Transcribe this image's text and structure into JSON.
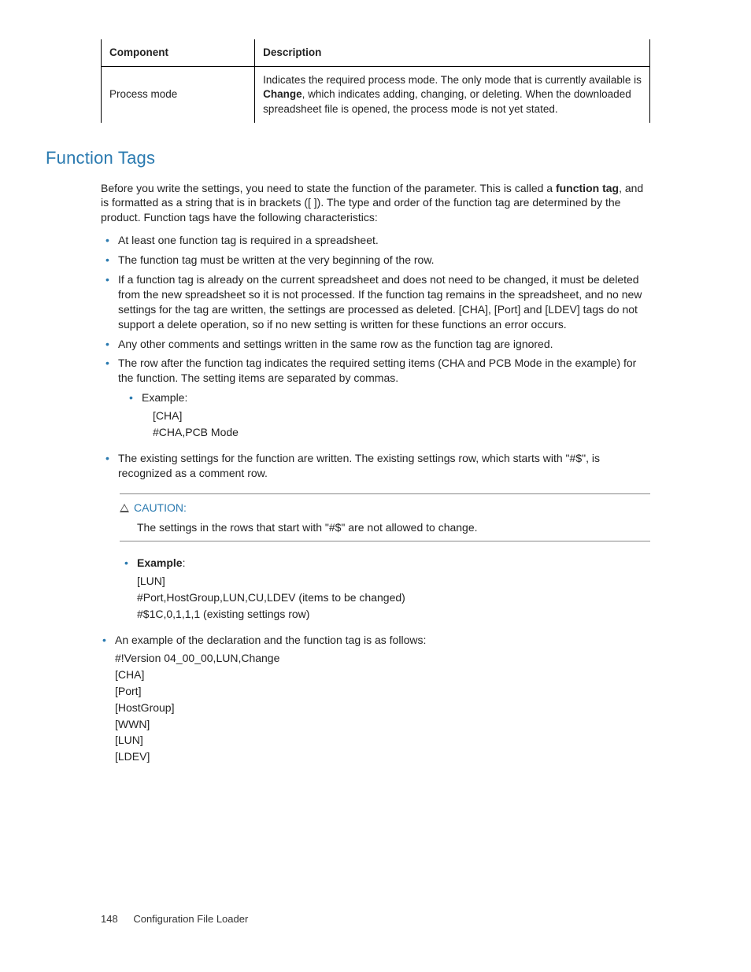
{
  "table": {
    "headers": {
      "col1": "Component",
      "col2": "Description"
    },
    "row": {
      "label": "Process mode",
      "desc_pre": "Indicates the required process mode. The only mode that is currently available is ",
      "desc_bold": "Change",
      "desc_post": ", which indicates adding, changing, or deleting. When the downloaded spreadsheet file is opened, the process mode is not yet stated."
    }
  },
  "section_heading": "Function Tags",
  "intro": {
    "pre": "Before you write the settings, you need to state the function of the parameter. This is called a ",
    "bold1": "function tag",
    "post": ", and is formatted as a string that is in brackets ([ ]). The type and order of the function tag are determined by the product. Function tags have the following characteristics:"
  },
  "bullets1": [
    "At least one function tag is required in a spreadsheet.",
    "The function tag must be written at the very beginning of the row.",
    "If a function tag is already on the current spreadsheet and does not need to be changed, it must be deleted from the new spreadsheet so it is not processed. If the function tag remains in the spreadsheet, and no new settings for the tag are written, the settings are processed as deleted. [CHA], [Port] and [LDEV] tags do not support a delete operation, so if no new setting is written for these functions an error occurs.",
    "Any other comments and settings written in the same row as the function tag are ignored.",
    "The row after the function tag indicates the required setting items (CHA and PCB Mode in the example) for the function. The setting items are separated by commas."
  ],
  "sub_example": {
    "label": "Example:",
    "line1": "[CHA]",
    "line2": "#CHA,PCB Mode"
  },
  "bullets2": [
    "The existing settings for the function are written. The existing settings row, which starts with \"#$\", is recognized as a comment row."
  ],
  "caution": {
    "label": "CAUTION:",
    "text": "The settings in the rows that start with \"#$\" are not allowed to change."
  },
  "example2": {
    "label": "Example",
    "colon": ":",
    "line1": "[LUN]",
    "line2": "#Port,HostGroup,LUN,CU,LDEV (items to be changed)",
    "line3": "#$1C,0,1,1,1 (existing settings row)"
  },
  "decl": {
    "intro": "An example of the declaration and the function tag is as follows:",
    "lines": [
      "#!Version 04_00_00,LUN,Change",
      "[CHA]",
      "[Port]",
      "[HostGroup]",
      "[WWN]",
      "[LUN]",
      "[LDEV]"
    ]
  },
  "footer": {
    "page": "148",
    "title": "Configuration File Loader"
  }
}
